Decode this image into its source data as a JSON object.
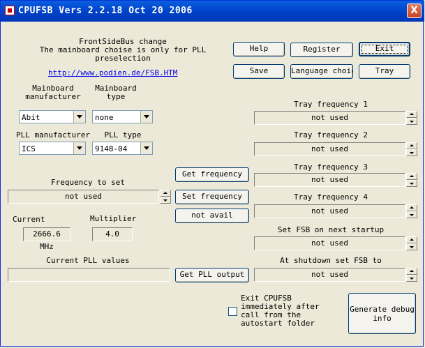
{
  "window": {
    "title": "CPUFSB  Vers 2.2.18  Oct 20 2006",
    "close_glyph": "X"
  },
  "header": {
    "line1": "FrontSideBus change",
    "line2": "The mainboard choise is only for PLL",
    "line3": "preselection",
    "link": "http://www.podien.de/FSB.HTM"
  },
  "buttons": {
    "help": "Help",
    "register": "Register",
    "exit": "Exit",
    "save": "Save",
    "language": "Language choice",
    "tray": "Tray",
    "get_frequency": "Get frequency",
    "set_frequency": "Set frequency",
    "not_avail": "not avail",
    "get_pll_output": "Get PLL output",
    "debug": "Generate debug info"
  },
  "mainboard": {
    "manufacturer_label": "Mainboard\nmanufacturer",
    "type_label": "Mainboard\ntype",
    "manufacturer_value": "Abit",
    "type_value": "none"
  },
  "pll": {
    "manufacturer_label": "PLL manufacturer",
    "type_label": "PLL type",
    "manufacturer_value": "ICS",
    "type_value": "9148-04"
  },
  "frequency_to_set": {
    "label": "Frequency to set",
    "value": "not used"
  },
  "current": {
    "label": "Current",
    "value": "2666.6 MHz"
  },
  "multiplier": {
    "label": "Multiplier",
    "value": "4.0"
  },
  "pll_values": {
    "label": "Current PLL values",
    "value": ""
  },
  "tray": [
    {
      "label": "Tray frequency 1",
      "value": "not used"
    },
    {
      "label": "Tray frequency 2",
      "value": "not used"
    },
    {
      "label": "Tray frequency 3",
      "value": "not used"
    },
    {
      "label": "Tray frequency 4",
      "value": "not used"
    }
  ],
  "next_startup": {
    "label": "Set FSB on next startup",
    "value": "not used"
  },
  "shutdown": {
    "label": "At shutdown set FSB to",
    "value": "not used"
  },
  "exit_checkbox": {
    "label": "Exit CPUFSB\nimmediately after\ncall from the\nautostart folder",
    "checked": false
  }
}
